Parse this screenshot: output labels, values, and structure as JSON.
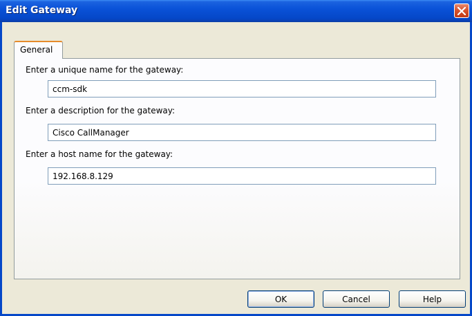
{
  "window": {
    "title": "Edit Gateway"
  },
  "tabs": [
    {
      "label": "General"
    }
  ],
  "form": {
    "name": {
      "label": "Enter a unique name for the gateway:",
      "value": "ccm-sdk"
    },
    "description": {
      "label": "Enter a description for the gateway:",
      "value": "Cisco CallManager"
    },
    "host": {
      "label": "Enter a host name for the gateway:",
      "value": "192.168.8.129"
    }
  },
  "buttons": {
    "ok": "OK",
    "cancel": "Cancel",
    "help": "Help"
  },
  "icons": {
    "close": "close-icon"
  }
}
